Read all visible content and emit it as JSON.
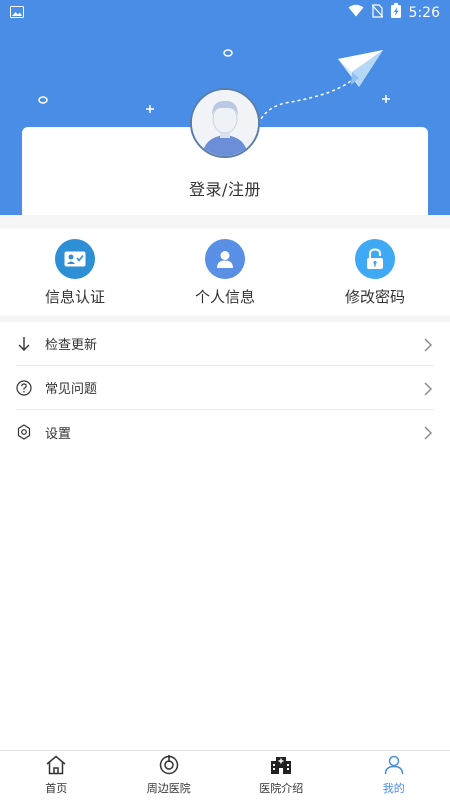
{
  "status_bar": {
    "time": "5:26"
  },
  "profile": {
    "login_label": "登录/注册"
  },
  "quick_actions": [
    {
      "label": "信息认证",
      "icon": "id-card-icon",
      "color": "#2e8fd6"
    },
    {
      "label": "个人信息",
      "icon": "person-icon",
      "color": "#5a8fe6"
    },
    {
      "label": "修改密码",
      "icon": "lock-icon",
      "color": "#3fa9f5"
    }
  ],
  "menu": [
    {
      "label": "检查更新",
      "icon": "arrow-down-icon"
    },
    {
      "label": "常见问题",
      "icon": "question-icon"
    },
    {
      "label": "设置",
      "icon": "gear-icon"
    }
  ],
  "bottom_nav": [
    {
      "label": "首页",
      "icon": "home-icon"
    },
    {
      "label": "周边医院",
      "icon": "location-icon"
    },
    {
      "label": "医院介绍",
      "icon": "hospital-icon"
    },
    {
      "label": "我的",
      "icon": "profile-icon",
      "active": true
    }
  ],
  "theme": {
    "primary": "#4a8de6"
  }
}
